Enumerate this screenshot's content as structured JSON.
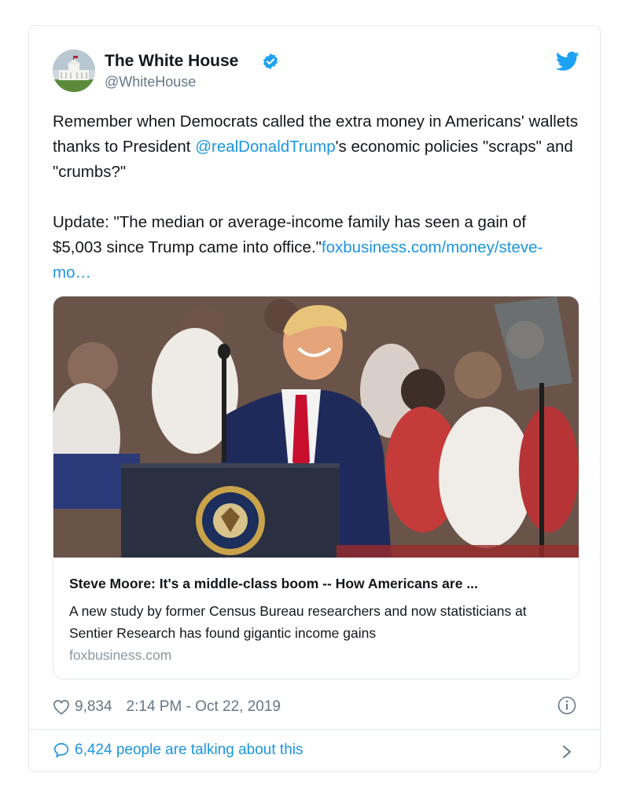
{
  "tweet": {
    "author_name": "The White House",
    "author_handle": "@WhiteHouse",
    "text_part1": "Remember when Democrats called the extra money in Americans' wallets thanks to President ",
    "mention": "@realDonaldTrump",
    "text_part2": "'s economic policies \"scraps\" and \"crumbs?\"",
    "text_part3": "Update: \"The median or average-income family has seen a gain of $5,003 since Trump came into office.\"",
    "url_text": "foxbusiness.com/money/steve-mo…",
    "likes": "9,834",
    "timestamp": "2:14 PM - Oct 22, 2019",
    "talking": "6,424 people are talking about this"
  },
  "link_card": {
    "title": "Steve Moore: It's a middle-class boom -- How Americans are ...",
    "description": "A new study by former Census Bureau researchers and now statisticians at Sentier Research has found gigantic income gains",
    "domain": "foxbusiness.com"
  },
  "icons": {
    "verified": "verified-badge-icon",
    "twitter": "twitter-bird-icon",
    "like": "heart-icon",
    "info": "info-icon",
    "reply": "speech-bubble-icon",
    "chevron": "chevron-right-icon"
  },
  "colors": {
    "link_blue": "#1b95e0",
    "muted_gray": "#657786",
    "border": "#e1e8ed"
  }
}
